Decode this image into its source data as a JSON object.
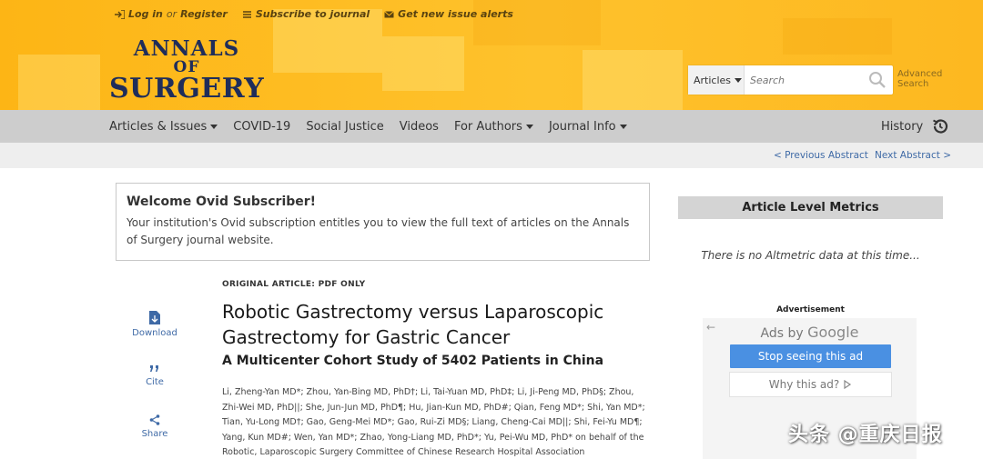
{
  "header": {
    "login": "Log in",
    "or": "or",
    "register": "Register",
    "subscribe": "Subscribe to journal",
    "alerts": "Get new issue alerts",
    "logo": {
      "line1": "ANNALS",
      "line2": "OF",
      "line3": "SURGERY"
    },
    "search": {
      "scope": "Articles",
      "placeholder": "Search",
      "advanced": "Advanced Search"
    }
  },
  "nav": {
    "items": [
      "Articles & Issues",
      "COVID-19",
      "Social Justice",
      "Videos",
      "For Authors",
      "Journal Info"
    ],
    "history": "History"
  },
  "subnav": {
    "prev": "< Previous Abstract",
    "next": "Next Abstract >"
  },
  "welcome": {
    "title": "Welcome Ovid Subscriber!",
    "text": "Your institution's Ovid subscription entitles you to view the full text of articles on the Annals of Surgery journal website."
  },
  "tools": {
    "download": "Download",
    "cite": "Cite",
    "share": "Share"
  },
  "article": {
    "type": "ORIGINAL ARTICLE: PDF ONLY",
    "title": "Robotic Gastrectomy versus Laparoscopic Gastrectomy for Gastric Cancer",
    "subtitle": "A Multicenter Cohort Study of 5402 Patients in China",
    "authors": "Li, Zheng-Yan MD*; Zhou, Yan-Bing MD, PhD†; Li, Tai-Yuan MD, PhD‡; Li, Ji-Peng MD, PhD§; Zhou, Zhi-Wei MD, PhD||; She, Jun-Jun MD, PhD¶; Hu, Jian-Kun MD, PhD#; Qian, Feng MD*; Shi, Yan MD*; Tian, Yu-Long MD†; Gao, Geng-Mei MD*; Gao, Rui-Zi MD§; Liang, Cheng-Cai MD||; Shi, Fei-Yu MD¶; Yang, Kun MD#; Wen, Yan MD*; Zhao, Yong-Liang MD, PhD*; Yu, Pei-Wu MD, PhD* on behalf of the Robotic, Laparoscopic Surgery Committee of Chinese Research Hospital Association"
  },
  "sidebar": {
    "metrics_title": "Article Level Metrics",
    "metrics_empty": "There is no Altmetric data at this time...",
    "ad_label": "Advertisement",
    "ads_by": "Ads by",
    "google": "Google",
    "stop": "Stop seeing this ad",
    "why": "Why this ad?"
  },
  "watermark": "头条 @重庆日报",
  "colors": {
    "header": "#fdb515",
    "logo": "#1f2d5a",
    "link": "#3f6aa6",
    "nav": "#cdcdcd",
    "ad_button": "#4a90e2"
  }
}
